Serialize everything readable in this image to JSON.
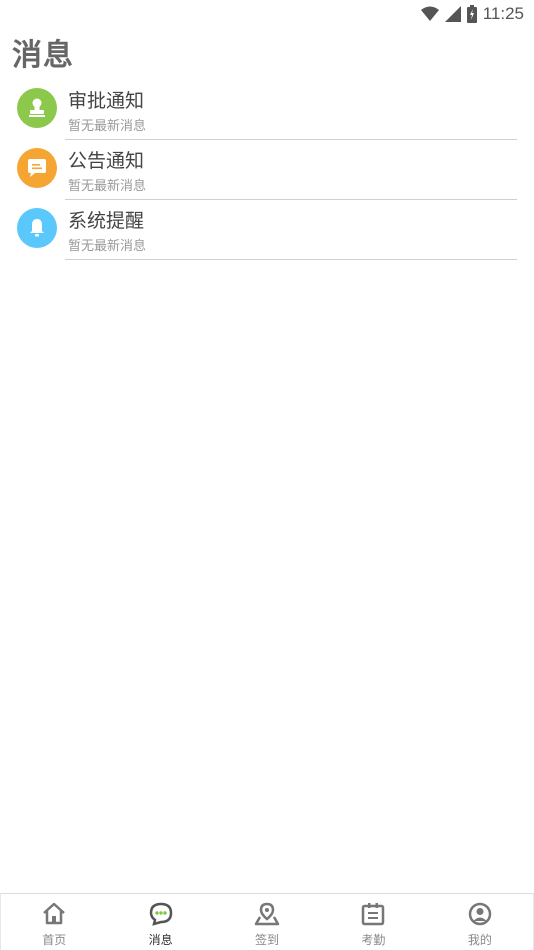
{
  "status_bar": {
    "time": "11:25"
  },
  "page": {
    "title": "消息"
  },
  "messages": [
    {
      "title": "审批通知",
      "subtitle": "暂无最新消息",
      "icon": "stamp-icon",
      "color": "#8cc84b"
    },
    {
      "title": "公告通知",
      "subtitle": "暂无最新消息",
      "icon": "announcement-icon",
      "color": "#f5a632"
    },
    {
      "title": "系统提醒",
      "subtitle": "暂无最新消息",
      "icon": "bell-icon",
      "color": "#5ac8fa"
    }
  ],
  "nav": {
    "items": [
      {
        "label": "首页",
        "icon": "home-icon"
      },
      {
        "label": "消息",
        "icon": "chat-icon",
        "active": true
      },
      {
        "label": "签到",
        "icon": "location-icon"
      },
      {
        "label": "考勤",
        "icon": "attendance-icon"
      },
      {
        "label": "我的",
        "icon": "profile-icon"
      }
    ]
  },
  "colors": {
    "accent": "#7ac943",
    "nav_icon": "#777777"
  }
}
